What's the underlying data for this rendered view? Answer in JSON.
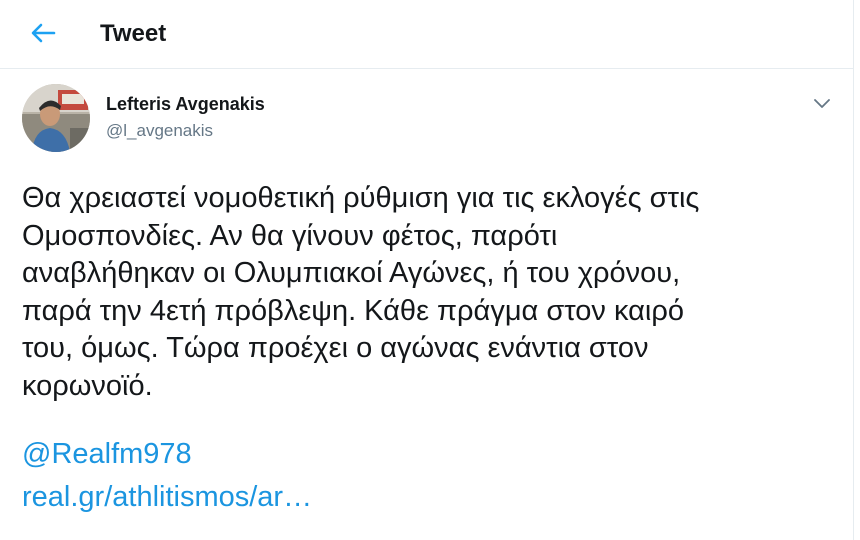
{
  "header": {
    "back_icon": "arrow-left-icon",
    "title": "Tweet"
  },
  "author": {
    "name": "Lefteris Avgenakis",
    "handle": "@l_avgenakis",
    "avatar_icon": "profile-photo",
    "menu_icon": "chevron-down-icon"
  },
  "tweet": {
    "text": "Θα χρειαστεί νομοθετική ρύθμιση για τις εκλογές στις\nΟμοσπονδίες. Αν θα γίνουν φέτος, παρότι\nαναβλήθηκαν οι Ολυμπιακοί Αγώνες, ή του χρόνου,\nπαρά την 4ετή πρόβλεψη. Κάθε πράγμα στον καιρό\nτου, όμως. Τώρα προέχει ο αγώνας ενάντια στον\nκορωνοϊό.",
    "mention": "@Realfm978",
    "link": "real.gr/athlitismos/ar…"
  },
  "colors": {
    "accent": "#1da1f2",
    "link": "#1b95e0",
    "text": "#14171a",
    "secondary": "#657786",
    "border": "#e6ecf0"
  }
}
